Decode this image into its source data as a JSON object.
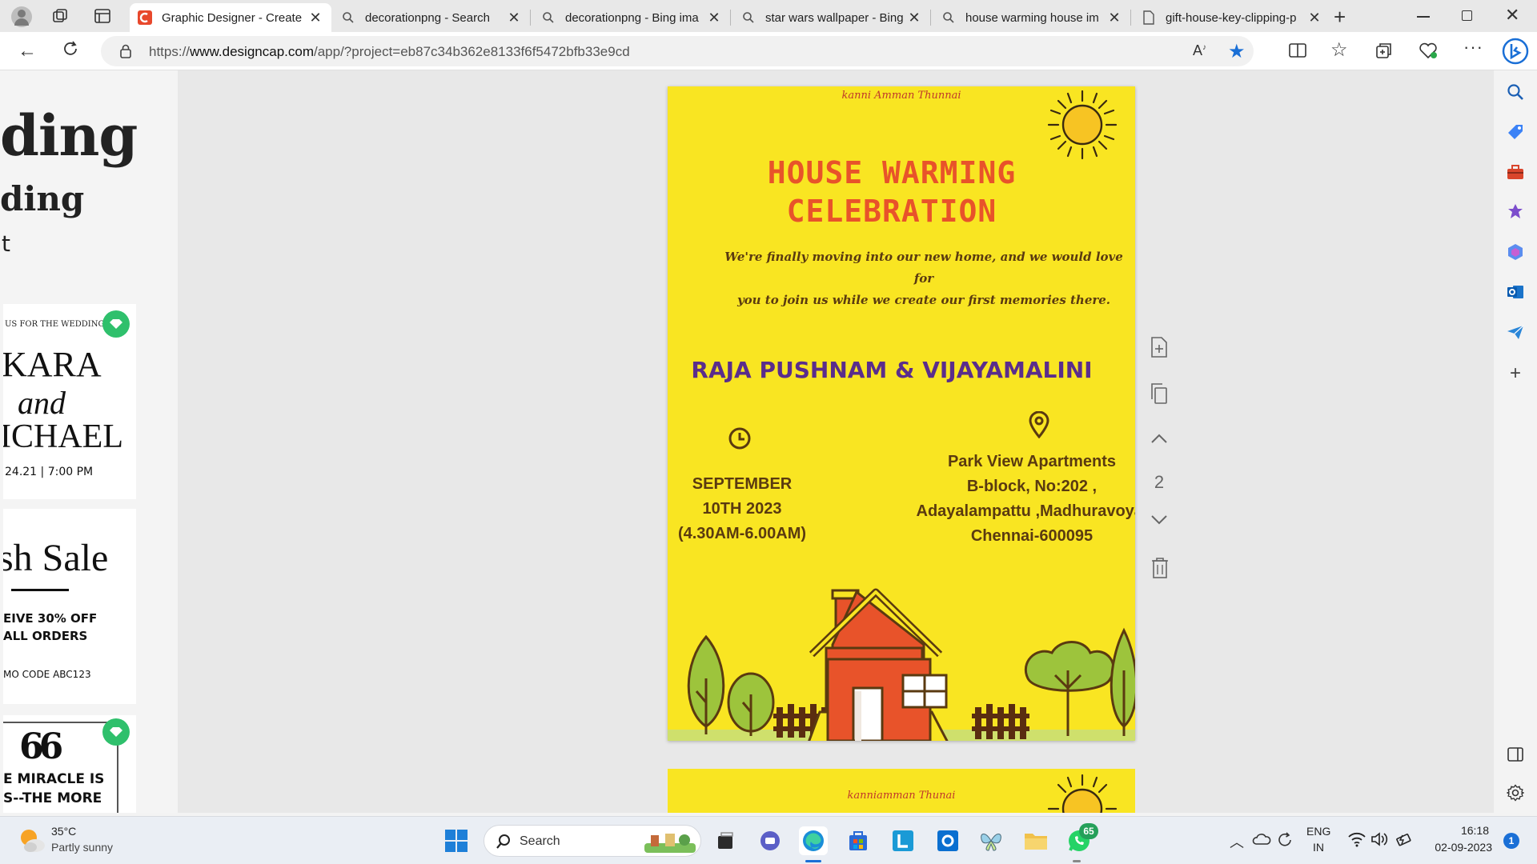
{
  "tabs": [
    {
      "label": "Graphic Designer - Create",
      "active": true
    },
    {
      "label": "decorationpng - Search"
    },
    {
      "label": "decorationpng - Bing ima"
    },
    {
      "label": "star wars wallpaper - Bing"
    },
    {
      "label": "house warming house im"
    },
    {
      "label": "gift-house-key-clipping-p"
    }
  ],
  "address": {
    "url_prefix": "https://",
    "url_domain": "www.designcap.com",
    "url_path": "/app/?project=eb87c34b362e8133f6f5472bfb33e9cd"
  },
  "left_panel": {
    "heading1": "ding",
    "heading2": "ding",
    "heading3": "t",
    "card1": {
      "line1": "US FOR THE WEDDING",
      "line2": "KARA",
      "line3": "and",
      "line4": "ICHAEL",
      "line5": "24.21  |  7:00 PM"
    },
    "card2": {
      "line1": "sh Sale",
      "line2": "EIVE 30% OFF",
      "line3": "ALL ORDERS",
      "line4": "MO CODE ABC123"
    },
    "card3": {
      "line1": "66",
      "line2": "E MIRACLE IS",
      "line3": "S--THE MORE"
    }
  },
  "poster": {
    "top_caption": "kanni Amman Thunnai",
    "title_line1": "HOUSE WARMING",
    "title_line2": "CELEBRATION",
    "message_line1": "We're finally moving into our new home, and we would love for",
    "message_line2": "you to join us while we create our first memories there.",
    "hosts": "RAJA PUSHNAM & VIJAYAMALINI",
    "date_line1": "SEPTEMBER",
    "date_line2": "10TH 2023",
    "date_line3": "(4.30AM-6.00AM)",
    "address_line1": "Park View Apartments",
    "address_line2": "B-block, No:202 ,",
    "address_line3": "Adayalampattu ,Madhuravoyal",
    "address_line4": "Chennai-600095",
    "colors": {
      "background": "#f9e522",
      "title": "#e8532a",
      "hosts": "#5a2d8c",
      "text": "#5a3a10"
    }
  },
  "poster2": {
    "top_caption": "kanniamman Thunai"
  },
  "page_tools": {
    "page_number": "2"
  },
  "taskbar": {
    "weather_temp": "35°C",
    "weather_desc": "Partly sunny",
    "search_placeholder": "Search",
    "lang1": "ENG",
    "lang2": "IN",
    "time": "16:18",
    "date": "02-09-2023",
    "whatsapp_badge": "65",
    "notification_count": "1"
  }
}
